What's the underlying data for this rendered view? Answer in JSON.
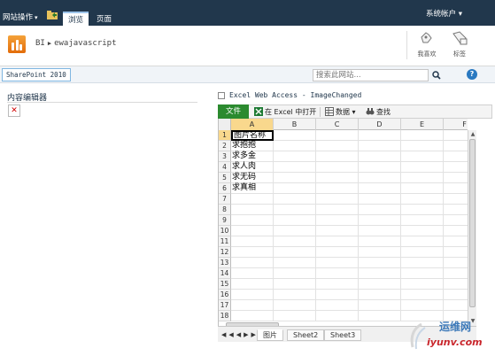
{
  "ribbon": {
    "site_actions": "网站操作",
    "tabs": [
      {
        "label": "浏览"
      },
      {
        "label": "页面"
      }
    ],
    "user_menu": "系统帐户"
  },
  "title_area": {
    "breadcrumb": [
      "BI",
      "ewajavascript"
    ],
    "actions": [
      {
        "label": "我喜欢"
      },
      {
        "label": "标签"
      }
    ]
  },
  "navbar": {
    "items": [
      "SharePoint 2010"
    ],
    "search_placeholder": "搜索此网站..."
  },
  "content_editor": {
    "title": "内容编辑器"
  },
  "excel_web_access": {
    "title": "Excel Web Access - ImageChanged",
    "toolbar": {
      "file": "文件",
      "open_in_excel": "在 Excel 中打开",
      "data": "数据",
      "find": "查找"
    },
    "columns": [
      "A",
      "B",
      "C",
      "D",
      "E",
      "F"
    ],
    "rows": [
      "1",
      "2",
      "3",
      "4",
      "5",
      "6",
      "7",
      "8",
      "9",
      "10",
      "11",
      "12",
      "13",
      "14",
      "15",
      "16",
      "17",
      "18"
    ],
    "cells_col_a": [
      "图片名称",
      "求抱抱",
      "求多金",
      "求人肉",
      "求无码",
      "求真相"
    ],
    "sheet_tabs": [
      "图片",
      "Sheet2",
      "Sheet3"
    ],
    "active_sheet": "图片",
    "selected_cell": "A1"
  },
  "watermark": {
    "line1": "运维网",
    "line2": "iyunv.com"
  }
}
